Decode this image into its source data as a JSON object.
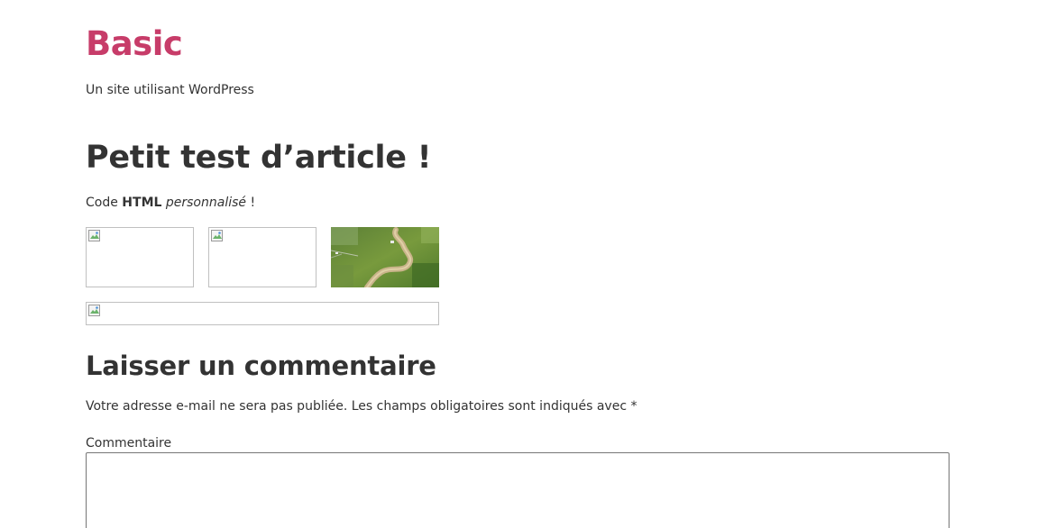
{
  "site": {
    "title": "Basic",
    "tagline": "Un site utilisant WordPress",
    "title_color": "#c73c69"
  },
  "article": {
    "title": "Petit test d’article !",
    "content": {
      "prefix": "Code ",
      "bold": "HTML",
      "space": " ",
      "italic": "personnalisé",
      "suffix": " !"
    },
    "images": [
      {
        "state": "broken",
        "icon": "broken-image-icon"
      },
      {
        "state": "broken",
        "icon": "broken-image-icon"
      },
      {
        "state": "loaded",
        "icon": "aerial-river-photo"
      },
      {
        "state": "broken",
        "icon": "broken-image-icon"
      }
    ]
  },
  "comments": {
    "title": "Laisser un commentaire",
    "notes": "Votre adresse e-mail ne sera pas publiée. Les champs obligatoires sont indiqués avec ",
    "required_mark": "*",
    "comment_label": "Commentaire",
    "comment_value": ""
  }
}
